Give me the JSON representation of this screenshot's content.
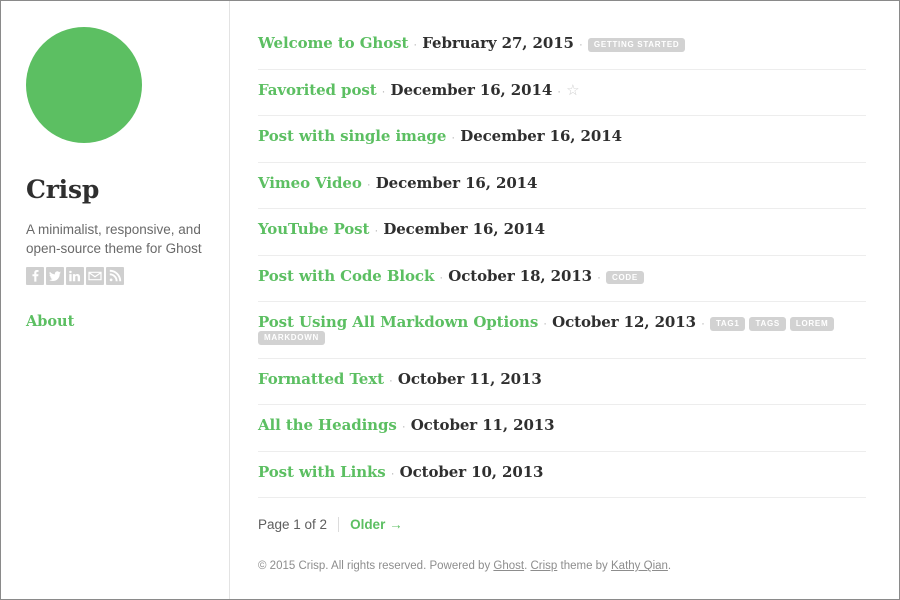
{
  "sidebar": {
    "avatar_color": "#5cbf62",
    "avatar_name": "site-avatar",
    "title": "Crisp",
    "description": "A minimalist, responsive, and open-source theme for Ghost",
    "social": [
      {
        "name": "facebook-icon",
        "glyph": "f"
      },
      {
        "name": "twitter-icon",
        "glyph": "t"
      },
      {
        "name": "linkedin-icon",
        "glyph": "in"
      },
      {
        "name": "email-icon",
        "glyph": "mail"
      },
      {
        "name": "rss-icon",
        "glyph": "rss"
      }
    ],
    "nav": [
      {
        "name": "sidebar-nav-about",
        "label": "About"
      }
    ]
  },
  "main": {
    "posts": [
      {
        "title": "Welcome to Ghost",
        "date": "February 27, 2015",
        "tags": [
          "GETTING STARTED"
        ],
        "favorited": false
      },
      {
        "title": "Favorited post",
        "date": "December 16, 2014",
        "tags": [],
        "favorited": true
      },
      {
        "title": "Post with single image",
        "date": "December 16, 2014",
        "tags": [],
        "favorited": false
      },
      {
        "title": "Vimeo Video",
        "date": "December 16, 2014",
        "tags": [],
        "favorited": false
      },
      {
        "title": "YouTube Post",
        "date": "December 16, 2014",
        "tags": [],
        "favorited": false
      },
      {
        "title": "Post with Code Block",
        "date": "October 18, 2013",
        "tags": [
          "CODE"
        ],
        "favorited": false
      },
      {
        "title": "Post Using All Markdown Options",
        "date": "October 12, 2013",
        "tags": [
          "TAG1",
          "TAGS",
          "LOREM",
          "MARKDOWN"
        ],
        "favorited": false
      },
      {
        "title": "Formatted Text",
        "date": "October 11, 2013",
        "tags": [],
        "favorited": false
      },
      {
        "title": "All the Headings",
        "date": "October 11, 2013",
        "tags": [],
        "favorited": false
      },
      {
        "title": "Post with Links",
        "date": "October 10, 2013",
        "tags": [],
        "favorited": false
      }
    ],
    "separator": "·",
    "star_glyph": "☆"
  },
  "pagination": {
    "page_label": "Page 1 of 2",
    "older_label": "Older →"
  },
  "footer": {
    "part1": "© 2015 Crisp. All rights reserved. Powered by ",
    "link1": "Ghost",
    "part2": ". ",
    "link2": "Crisp",
    "part3": " theme by ",
    "link3": "Kathy Qian",
    "part4": "."
  },
  "colors": {
    "accent_green": "#5cbf62",
    "text_dark": "#2f2f2f",
    "text_muted": "#8d8d8d",
    "tag_bg": "#d2d2d2",
    "rule": "#ededed"
  }
}
